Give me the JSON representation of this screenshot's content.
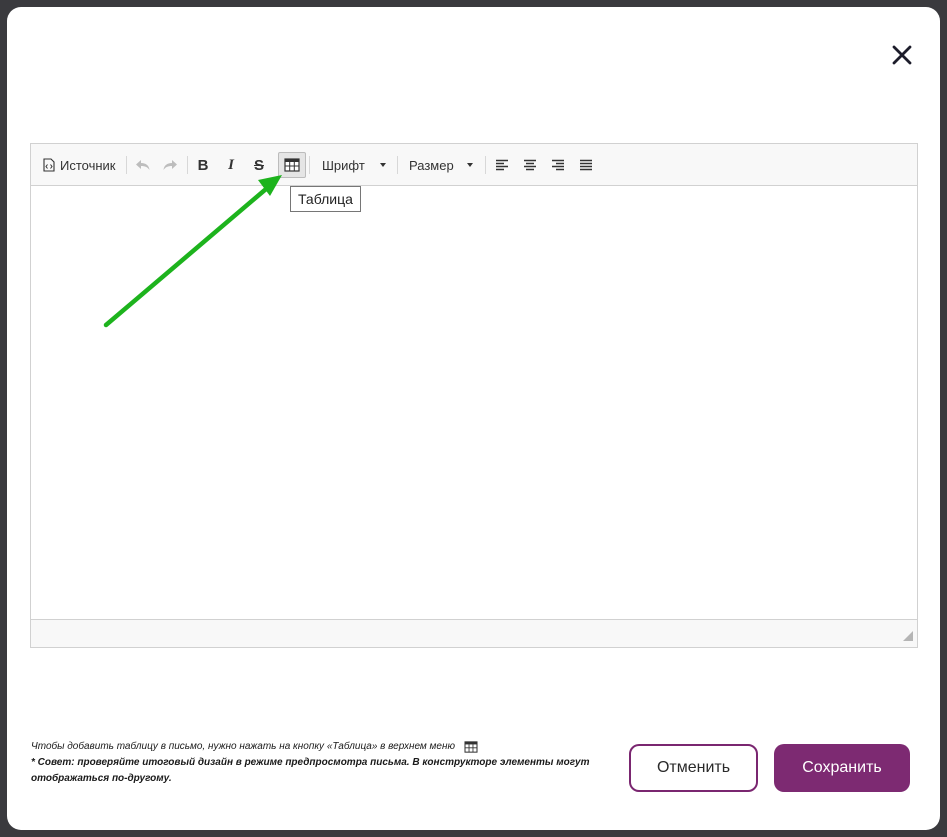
{
  "dialog": {
    "close_icon": "close-icon"
  },
  "toolbar": {
    "source_label": "Источник",
    "font_label": "Шрифт",
    "size_label": "Размер",
    "icons": [
      "source-icon",
      "undo-icon",
      "redo-icon",
      "bold-icon",
      "italic-icon",
      "strikethrough-icon",
      "table-icon",
      "align-left-icon",
      "align-center-icon",
      "align-right-icon",
      "align-justify-icon"
    ]
  },
  "format": {
    "bold": "B",
    "italic": "I",
    "strike": "S"
  },
  "tooltip": {
    "text": "Таблица"
  },
  "annotation": {
    "arrow_color": "#1db31d"
  },
  "footer": {
    "hint_line1": "Чтобы добавить таблицу в письмо, нужно нажать на кнопку «Таблица» в верхнем меню",
    "hint_line2": "* Совет: проверяйте итоговый дизайн в режиме предпросмотра письма. В конструкторе элементы могут отображаться по-другому.",
    "cancel_label": "Отменить",
    "save_label": "Сохранить"
  },
  "colors": {
    "accent": "#7d2a72",
    "overlay": "#3a3a3e"
  }
}
